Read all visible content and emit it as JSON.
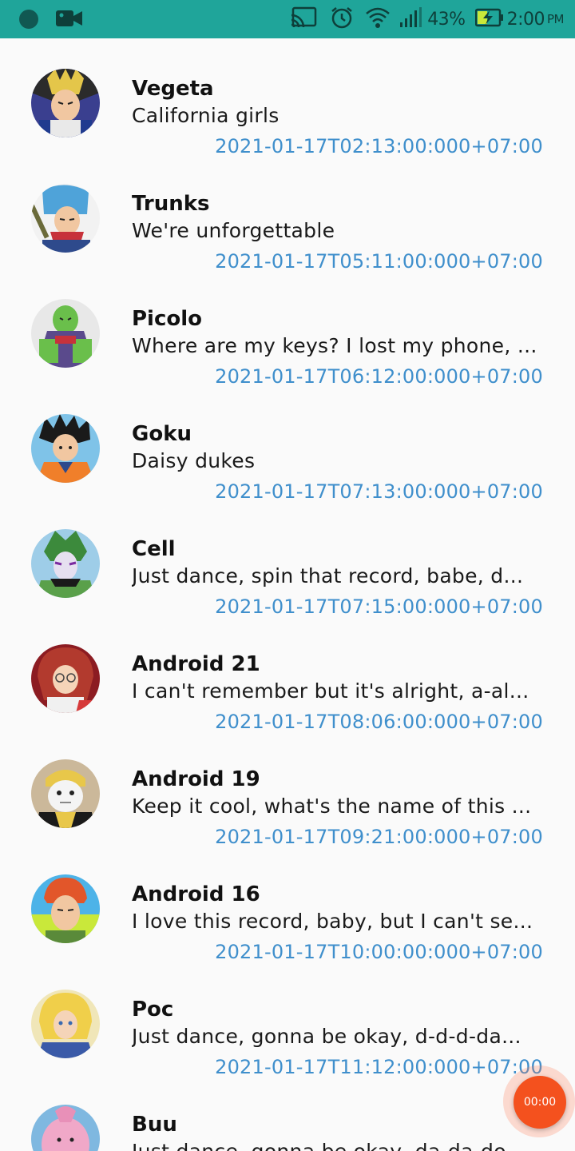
{
  "status_bar": {
    "battery": "43%",
    "time": "2:00",
    "ampm": "PM",
    "icons": [
      "circle-indicator-icon",
      "video-camera-icon",
      "cast-icon",
      "alarm-icon",
      "wifi-icon",
      "signal-icon",
      "battery-charging-icon"
    ],
    "background_color": "#1fa59a"
  },
  "chats": [
    {
      "name": "Vegeta",
      "message": "California girls",
      "time": "2021-01-17T02:13:00:000+07:00",
      "avatar": "vegeta-avatar"
    },
    {
      "name": "Trunks",
      "message": "We're unforgettable",
      "time": "2021-01-17T05:11:00:000+07:00",
      "avatar": "trunks-avatar"
    },
    {
      "name": "Picolo",
      "message": "Where are my keys? I lost my phone, ...",
      "time": "2021-01-17T06:12:00:000+07:00",
      "avatar": "picolo-avatar"
    },
    {
      "name": "Goku",
      "message": "Daisy dukes",
      "time": "2021-01-17T07:13:00:000+07:00",
      "avatar": "goku-avatar"
    },
    {
      "name": "Cell",
      "message": "Just dance, spin that record, babe, d...",
      "time": "2021-01-17T07:15:00:000+07:00",
      "avatar": "cell-avatar"
    },
    {
      "name": "Android 21",
      "message": "I can't remember but it's alright, a-al...",
      "time": "2021-01-17T08:06:00:000+07:00",
      "avatar": "android-21-avatar"
    },
    {
      "name": "Android 19",
      "message": "Keep it cool, what's the name of this ...",
      "time": "2021-01-17T09:21:00:000+07:00",
      "avatar": "android-19-avatar"
    },
    {
      "name": "Android 16",
      "message": "I love this record, baby, but I can't se...",
      "time": "2021-01-17T10:00:00:000+07:00",
      "avatar": "android-16-avatar"
    },
    {
      "name": "Poc",
      "message": "Just dance, gonna be okay, d-d-d-da...",
      "time": "2021-01-17T11:12:00:000+07:00",
      "avatar": "poc-avatar"
    },
    {
      "name": "Buu",
      "message": "Just dance, gonna be okay, da-da-do...",
      "time": "",
      "avatar": "buu-avatar"
    }
  ],
  "fab": {
    "label": "00:00",
    "color": "#f4511e"
  },
  "colors": {
    "timestamp": "#3f8fcc",
    "name": "#111111",
    "background": "#fafafa"
  }
}
